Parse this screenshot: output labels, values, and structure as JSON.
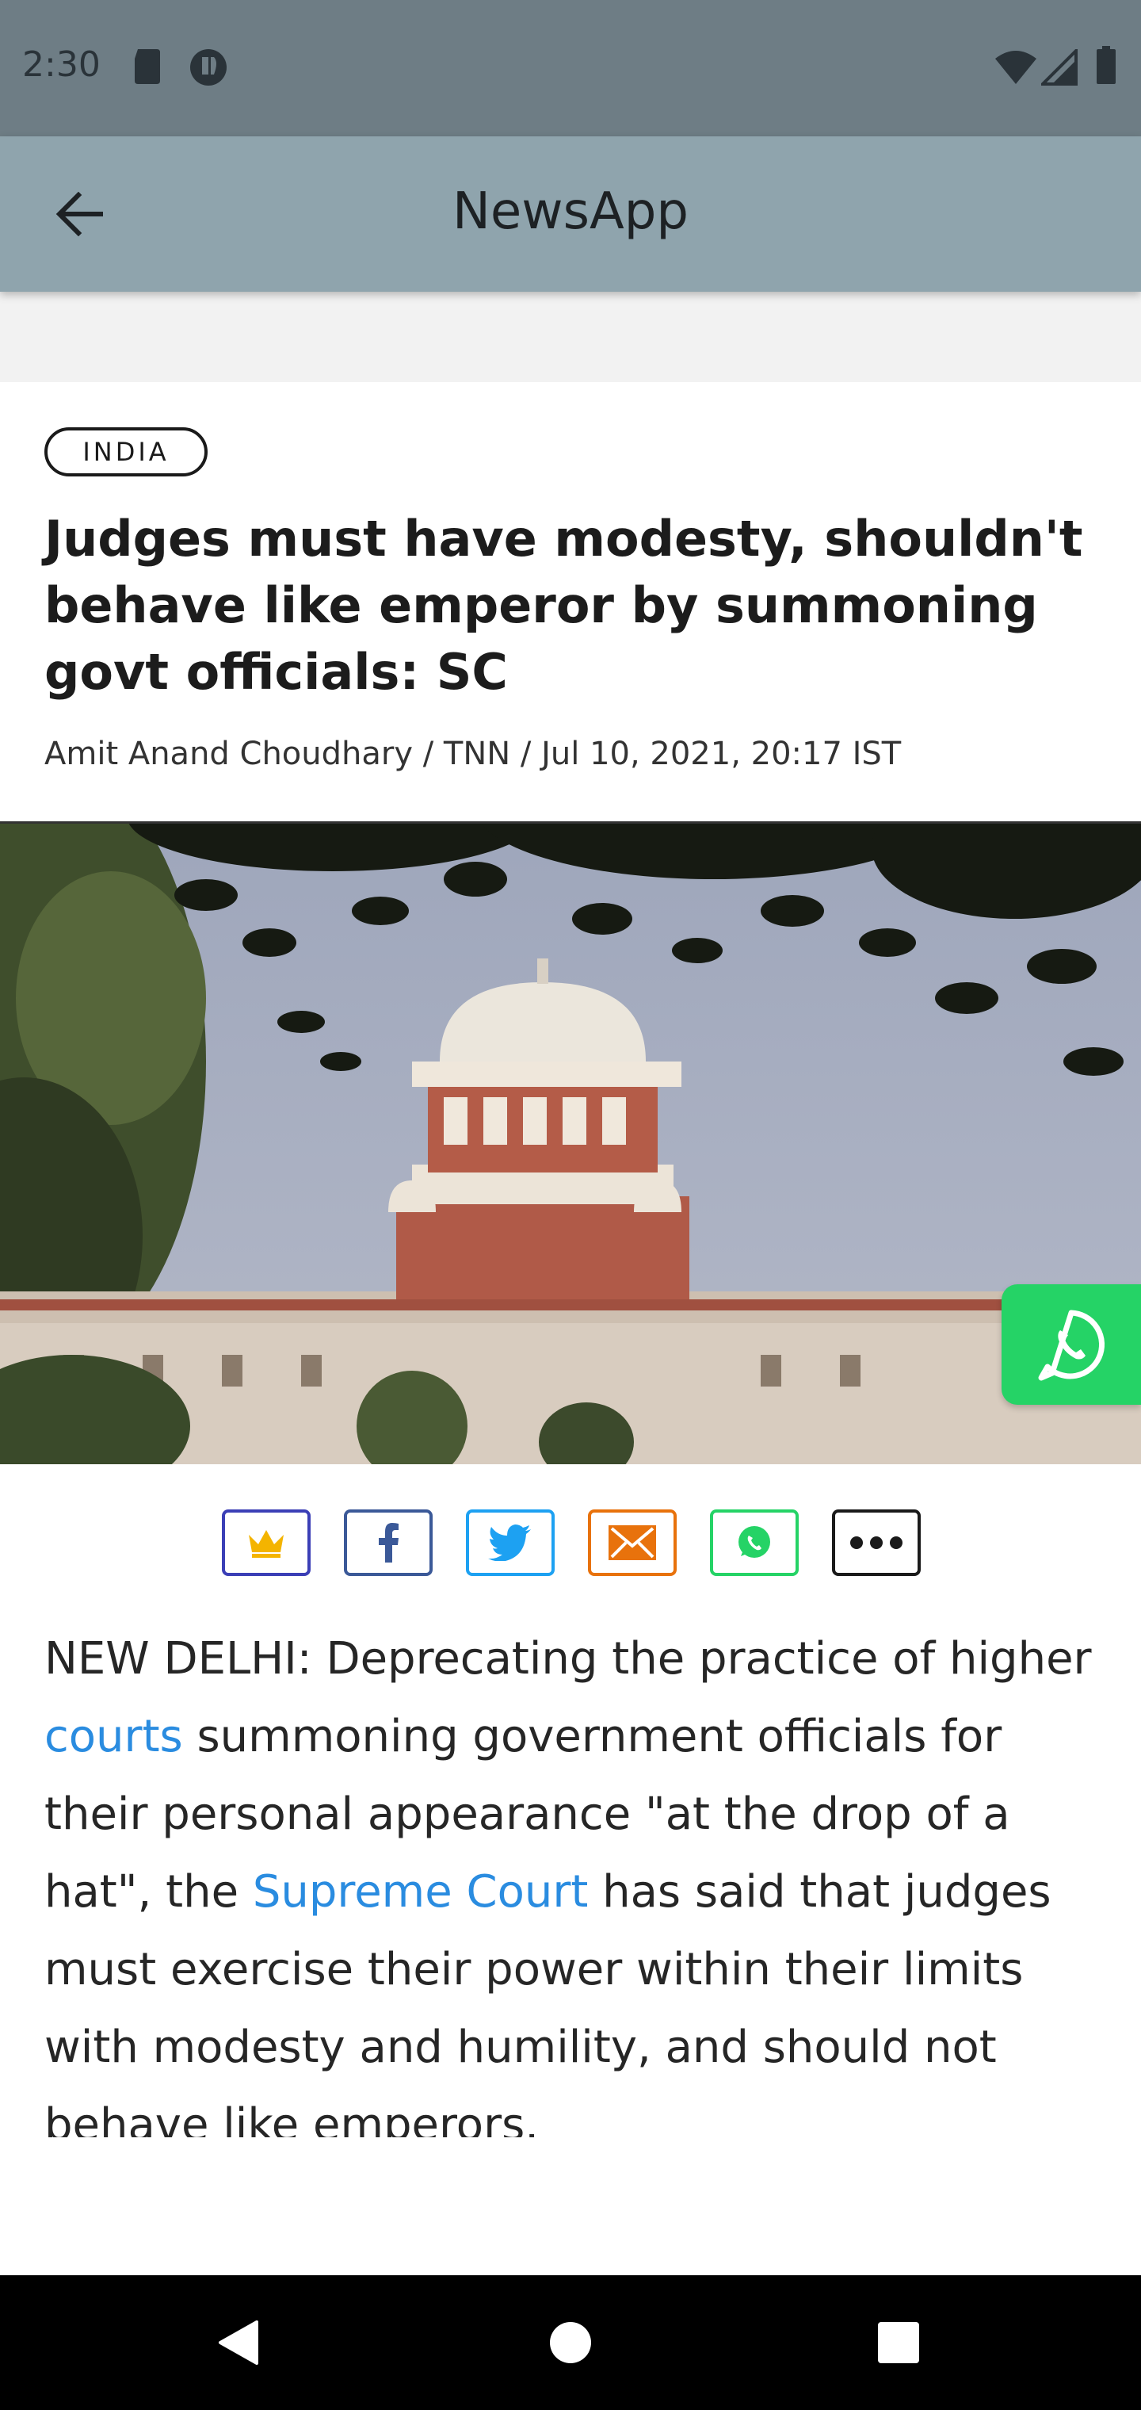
{
  "status_bar": {
    "time": "2:30",
    "left_icons": [
      "sd-card-icon",
      "shield-icon"
    ],
    "right_icons": [
      "wifi-icon",
      "signal-icon",
      "battery-icon"
    ]
  },
  "app_bar": {
    "title": "NewsApp",
    "back_icon": "arrow-left-icon"
  },
  "article": {
    "category": "INDIA",
    "headline": "Judges must have modesty, shouldn't behave like emperor by summoning govt officials: SC",
    "byline": "Amit Anand Choudhary / TNN / Jul 10, 2021, 20:17 IST",
    "body": {
      "p1_a": "NEW DELHI: Deprecating the practice of higher ",
      "link1": "courts",
      "p1_b": " summoning government officials for their personal appearance \"at the drop of a hat\", the ",
      "link2": "Supreme Court",
      "p1_c": " has said that judges must exercise their power within their limits with modesty and humility, and should not behave like emperors."
    }
  },
  "share_buttons": [
    {
      "name": "premium-share-button",
      "icon": "crown-icon",
      "color": "#3b3fb6"
    },
    {
      "name": "facebook-share-button",
      "icon": "facebook-icon",
      "color": "#3b5998"
    },
    {
      "name": "twitter-share-button",
      "icon": "twitter-icon",
      "color": "#1da1f2"
    },
    {
      "name": "email-share-button",
      "icon": "envelope-icon",
      "color": "#e8720c"
    },
    {
      "name": "whatsapp-share-button",
      "icon": "whatsapp-icon",
      "color": "#25d366"
    },
    {
      "name": "more-share-button",
      "icon": "more-icon",
      "color": "#1a1a1a"
    }
  ],
  "floating_button": {
    "icon": "whatsapp-icon",
    "color": "#25d366"
  },
  "nav_bar": [
    "back-triangle-icon",
    "home-circle-icon",
    "recents-square-icon"
  ]
}
